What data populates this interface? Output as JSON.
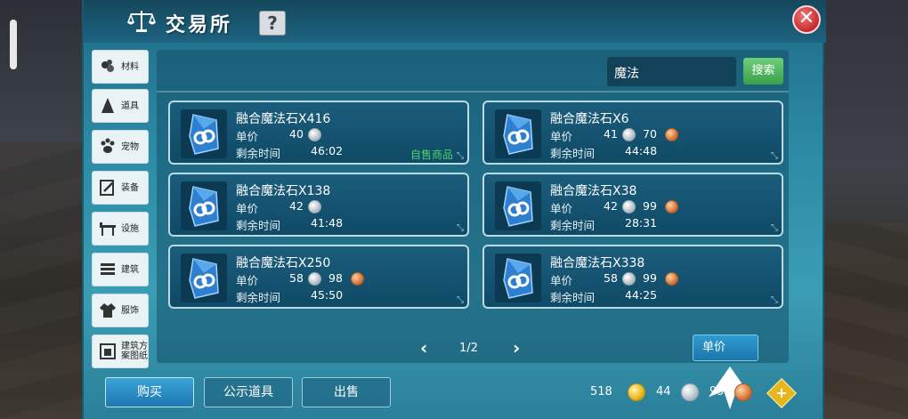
{
  "header": {
    "title": "交易所",
    "help_label": "?",
    "close_label": "✕"
  },
  "sidebar": {
    "items": [
      {
        "label": "材料",
        "icon": "material-icon"
      },
      {
        "label": "道具",
        "icon": "item-icon"
      },
      {
        "label": "宠物",
        "icon": "pet-paw-icon"
      },
      {
        "label": "装备",
        "icon": "equipment-icon"
      },
      {
        "label": "设施",
        "icon": "facility-icon"
      },
      {
        "label": "建筑",
        "icon": "building-icon"
      },
      {
        "label": "服饰",
        "icon": "clothing-icon"
      },
      {
        "label": "建筑方案图纸",
        "icon": "blueprint-icon"
      }
    ]
  },
  "search": {
    "value": "魔法",
    "button_label": "搜索"
  },
  "labels": {
    "price": "单价",
    "time_left": "剩余时间",
    "self_sale": "自售商品"
  },
  "listings": [
    {
      "name": "融合魔法石X416",
      "silver": "40",
      "copper": "",
      "time": "46:02",
      "self_sale": true
    },
    {
      "name": "融合魔法石X6",
      "silver": "41",
      "copper": "70",
      "time": "44:48",
      "self_sale": false
    },
    {
      "name": "融合魔法石X138",
      "silver": "42",
      "copper": "",
      "time": "41:48",
      "self_sale": false
    },
    {
      "name": "融合魔法石X38",
      "silver": "42",
      "copper": "99",
      "time": "28:31",
      "self_sale": false
    },
    {
      "name": "融合魔法石X250",
      "silver": "58",
      "copper": "98",
      "time": "45:50",
      "self_sale": false
    },
    {
      "name": "融合魔法石X338",
      "silver": "58",
      "copper": "99",
      "time": "44:25",
      "self_sale": false
    }
  ],
  "pager": {
    "page": "1/2",
    "prev": "‹",
    "next": "›"
  },
  "sort": {
    "label": "单价"
  },
  "tabs": {
    "buy": "购买",
    "public": "公示道具",
    "sell": "出售"
  },
  "currency": {
    "gold": "518",
    "silver": "44",
    "copper": "99",
    "add": "+"
  },
  "colors": {
    "accent": "#2c8aa4",
    "sale_green": "#4cd46a",
    "close_red": "#c42a2a"
  }
}
